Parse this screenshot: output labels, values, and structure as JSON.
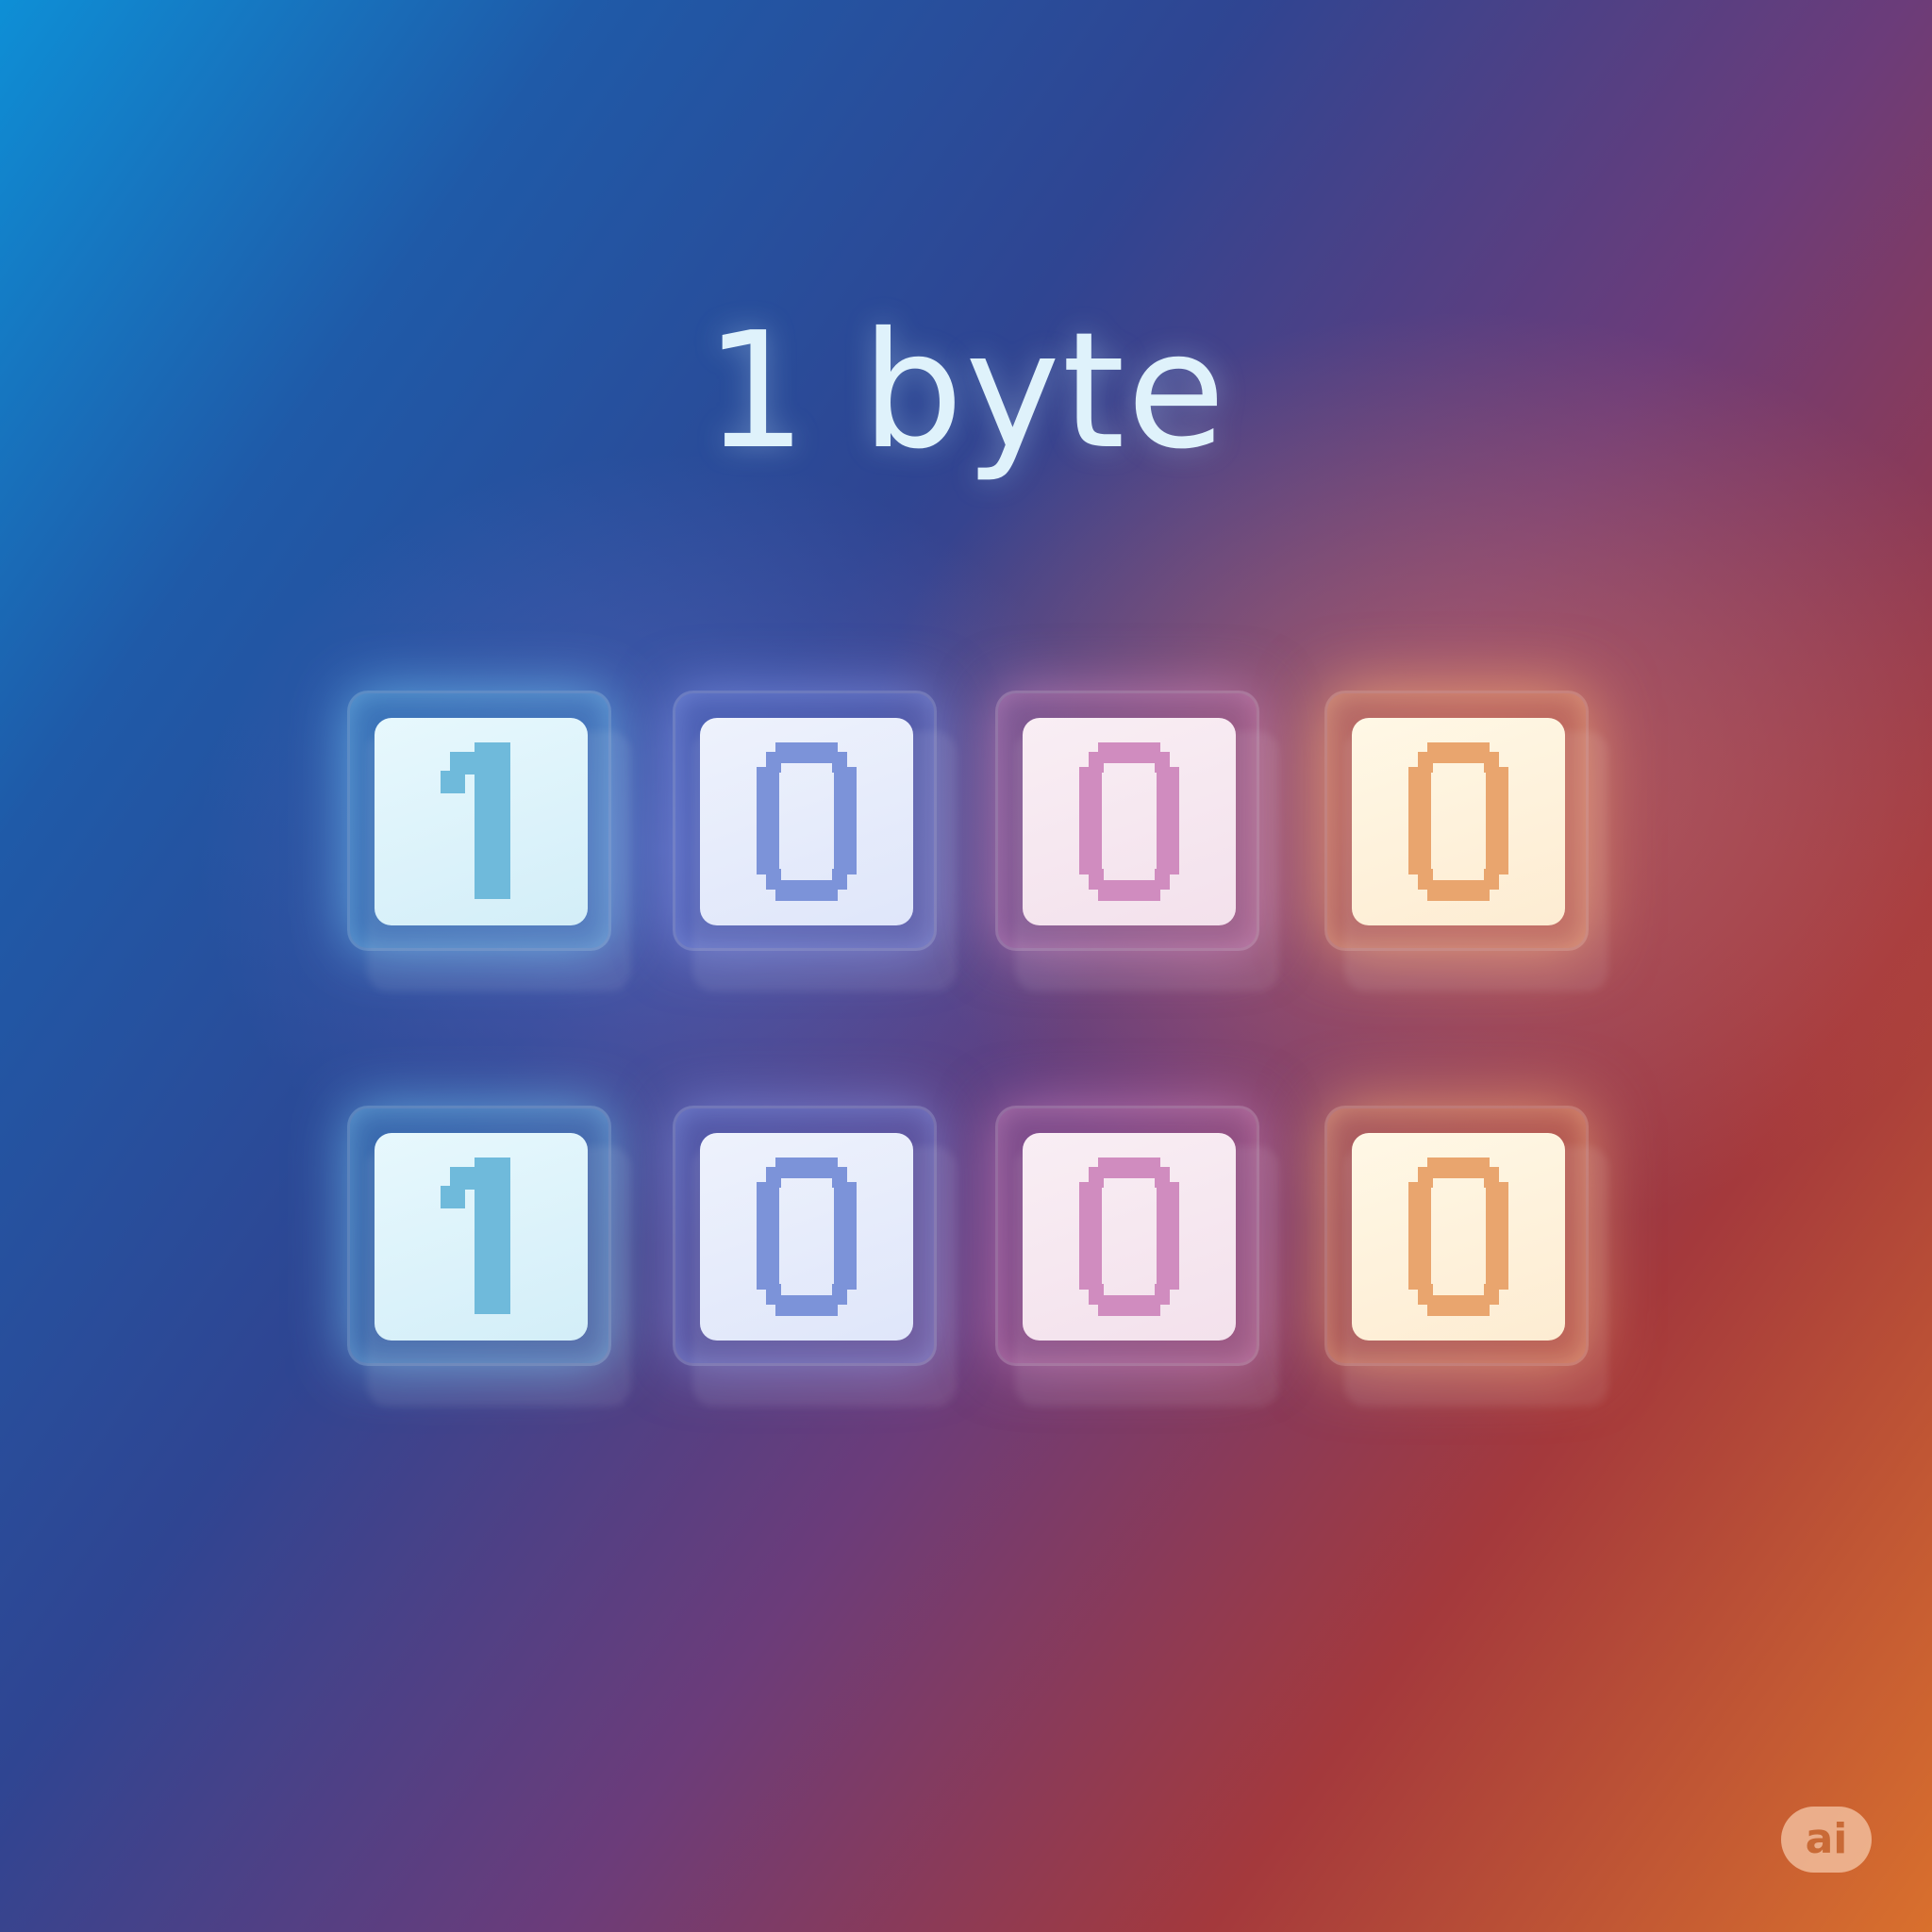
{
  "title": "1 byte",
  "bits": [
    {
      "value": "1",
      "color": "#6fbadb"
    },
    {
      "value": "0",
      "color": "#7c93d9"
    },
    {
      "value": "0",
      "color": "#d08cbf"
    },
    {
      "value": "0",
      "color": "#e9a56e"
    },
    {
      "value": "1",
      "color": "#6fbadb"
    },
    {
      "value": "0",
      "color": "#7c93d9"
    },
    {
      "value": "0",
      "color": "#d08cbf"
    },
    {
      "value": "0",
      "color": "#e9a56e"
    }
  ],
  "badge": {
    "label": "ai",
    "icon": "ai-badge-icon"
  }
}
